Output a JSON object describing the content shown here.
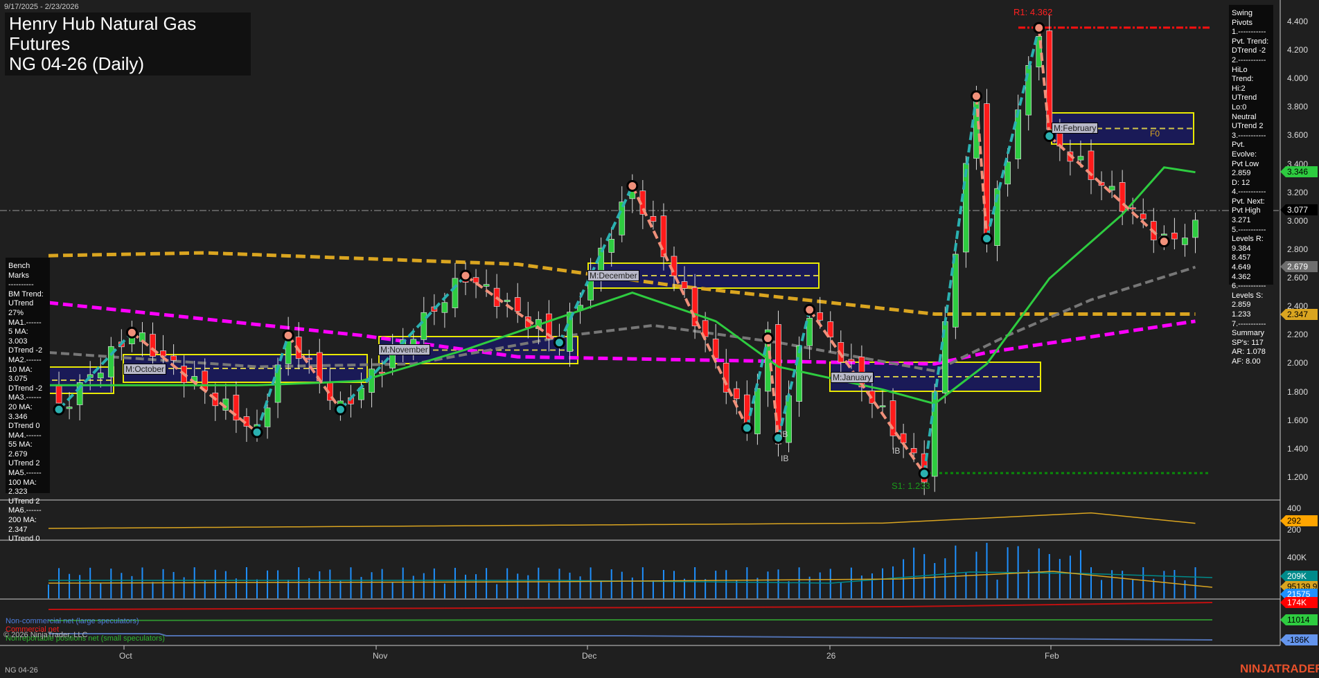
{
  "header": {
    "date_range": "9/17/2025 - 2/23/2026",
    "title_line1": "Henry Hub Natural Gas Futures",
    "title_line2": "NG 04-26 (Daily)"
  },
  "swing_pivots_panel": [
    "Swing Pivots",
    "1.-----------",
    "Pvt. Trend:",
    "DTrend -2",
    "2.-----------",
    "HiLo Trend:",
    "Hi:2 UTrend",
    "Lo:0 Neutral",
    "UTrend 2",
    "3.-----------",
    "Pvt. Evolve:",
    "Pvt Low",
    "2.859",
    "D: 12",
    "4.-----------",
    "Pvt. Next:",
    "Pvt High",
    "3.271",
    "5.-----------",
    "Levels R:",
    "9.384",
    "8.457",
    "4.649",
    "4.362",
    "6.-----------",
    "Levels S:",
    "2.859",
    "1.233",
    "7.-----------",
    "Summary",
    "SP's: 117",
    "AR: 1.078",
    "AF: 8.00"
  ],
  "bench_marks_panel": [
    "Bench Marks",
    "----------",
    "BM Trend:",
    "UTrend 27%",
    "MA1.------",
    "5 MA:",
    "3.003",
    "DTrend -2",
    "MA2.------",
    "10 MA:",
    "3.075",
    "DTrend -2",
    "MA3.------",
    "20 MA:",
    "3.346",
    "DTrend 0",
    "MA4.------",
    "55 MA:",
    "2.679",
    "UTrend 2",
    "MA5.------",
    "100 MA:",
    "2.323",
    "UTrend 2",
    "MA6.------",
    "200 MA:",
    "2.347",
    "UTrend 0"
  ],
  "price_axis": {
    "ticks": [
      "4.400",
      "4.200",
      "4.000",
      "3.800",
      "3.600",
      "3.400",
      "3.200",
      "3.000",
      "2.800",
      "2.600",
      "2.400",
      "2.200",
      "2.000",
      "1.800",
      "1.600",
      "1.400",
      "1.200"
    ],
    "badges": [
      {
        "value": "3.346",
        "bg": "#2ecc40",
        "fg": "#000"
      },
      {
        "value": "3.077",
        "bg": "#000",
        "fg": "#fff"
      },
      {
        "value": "2.679",
        "bg": "#6e6e6e",
        "fg": "#fff"
      },
      {
        "value": "2.347",
        "bg": "#daa520",
        "fg": "#000"
      }
    ]
  },
  "annotations": {
    "r1": "R1: 4.362",
    "s1": "S1: 1.233",
    "f0": "F0",
    "ib": "IB",
    "months": [
      "M:October",
      "M:November",
      "M:December",
      "M:January",
      "M:February"
    ]
  },
  "indicator_panel": {
    "ticks": [
      "400",
      "200"
    ],
    "badge": "292"
  },
  "volume_panel": {
    "ticks": [
      "400K"
    ],
    "badges": [
      {
        "value": "209K",
        "bg": "#008b8b",
        "fg": "#fff"
      },
      {
        "value": "95139.92",
        "bg": "#daa520",
        "fg": "#000"
      },
      {
        "value": "21575",
        "bg": "#1e90ff",
        "fg": "#fff"
      }
    ]
  },
  "cot_panel": {
    "legend": [
      "Non-commercial net (large speculators)",
      "Commercial net",
      "Nonreportable positions net (small speculators)"
    ],
    "badges": [
      {
        "value": "174K",
        "bg": "#ff0000",
        "fg": "#fff"
      },
      {
        "value": "11014",
        "bg": "#2ecc40",
        "fg": "#000"
      },
      {
        "value": "-186K",
        "bg": "#6495ed",
        "fg": "#000"
      }
    ]
  },
  "x_axis": [
    "Oct",
    "Nov",
    "Dec",
    "26",
    "Feb"
  ],
  "footer": {
    "instrument": "NG 04-26",
    "copyright": "© 2026 NinjaTrader, LLC",
    "brand": "NINJATRADER"
  },
  "chart_data": {
    "type": "candlestick",
    "bars": 110,
    "swing_pivots": [
      [
        0,
        1.85
      ],
      [
        1,
        1.68
      ],
      [
        8,
        2.22
      ],
      [
        20,
        1.52
      ],
      [
        23,
        2.2
      ],
      [
        28,
        1.68
      ],
      [
        40,
        2.62
      ],
      [
        49,
        2.15
      ],
      [
        56,
        3.25
      ],
      [
        67,
        1.55
      ],
      [
        69,
        2.18
      ],
      [
        70,
        1.48
      ],
      [
        73,
        2.38
      ],
      [
        84,
        1.23
      ],
      [
        89,
        3.88
      ],
      [
        90,
        2.88
      ],
      [
        95,
        4.36
      ],
      [
        96,
        3.6
      ],
      [
        107,
        2.86
      ],
      [
        110,
        2.95
      ]
    ],
    "ma200": [
      [
        0,
        2.76
      ],
      [
        15,
        2.78
      ],
      [
        45,
        2.7
      ],
      [
        60,
        2.55
      ],
      [
        85,
        2.35
      ],
      [
        110,
        2.35
      ]
    ],
    "ma100": [
      [
        0,
        2.43
      ],
      [
        30,
        2.2
      ],
      [
        45,
        2.05
      ],
      [
        60,
        2.03
      ],
      [
        85,
        2.0
      ],
      [
        90,
        2.08
      ],
      [
        110,
        2.3
      ]
    ],
    "ma55": [
      [
        0,
        2.08
      ],
      [
        20,
        1.98
      ],
      [
        35,
        2.0
      ],
      [
        50,
        2.2
      ],
      [
        58,
        2.27
      ],
      [
        70,
        2.15
      ],
      [
        85,
        1.95
      ],
      [
        92,
        2.2
      ],
      [
        100,
        2.45
      ],
      [
        110,
        2.68
      ]
    ],
    "ma20": [
      [
        0,
        1.85
      ],
      [
        20,
        1.85
      ],
      [
        30,
        1.88
      ],
      [
        40,
        2.1
      ],
      [
        50,
        2.35
      ],
      [
        56,
        2.5
      ],
      [
        64,
        2.3
      ],
      [
        70,
        1.98
      ],
      [
        80,
        1.82
      ],
      [
        85,
        1.72
      ],
      [
        90,
        2.0
      ],
      [
        96,
        2.6
      ],
      [
        103,
        3.05
      ],
      [
        107,
        3.38
      ],
      [
        110,
        3.346
      ]
    ],
    "r1": 4.362,
    "s1": 1.233,
    "last": 3.077
  }
}
